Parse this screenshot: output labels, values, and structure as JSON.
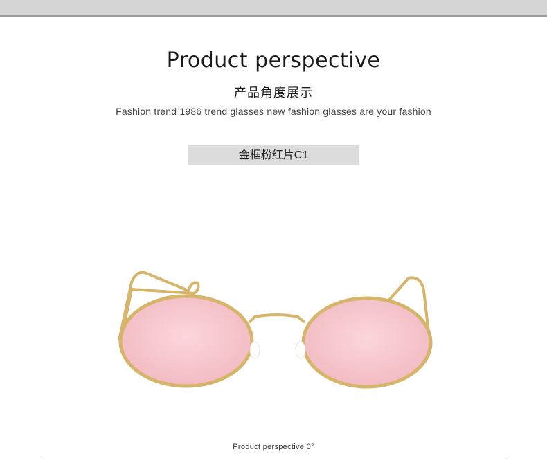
{
  "page": {
    "title": "Product perspective",
    "subtitle_cn": "产品角度展示",
    "tagline": "Fashion trend 1986 trend glasses new fashion glasses are your fashion",
    "variant_label": "金框粉红片C1",
    "caption": "Product perspective 0°"
  },
  "product_image": {
    "subject": "oval sunglasses, gold metal frame, pink lenses",
    "frame_color": "#d6b46a",
    "lens_color": "#f6c6cc"
  },
  "colors": {
    "top_bar": "#d6d6d6",
    "variant_box": "#dcdcdc",
    "rule": "#bcbcbc"
  }
}
